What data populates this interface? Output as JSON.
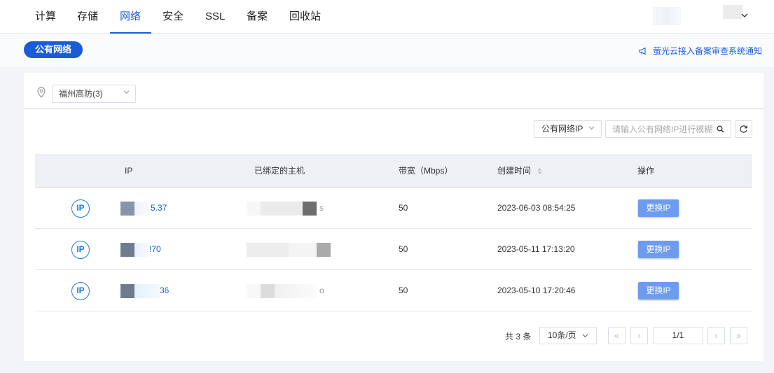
{
  "nav": {
    "tabs": [
      {
        "label": "计算"
      },
      {
        "label": "存储"
      },
      {
        "label": "网络"
      },
      {
        "label": "安全"
      },
      {
        "label": "SSL"
      },
      {
        "label": "备案"
      },
      {
        "label": "回收站"
      }
    ],
    "active_tab": "网络"
  },
  "subheader": {
    "pill_label": "公有网络",
    "notice_text": "萤光云接入备案审查系统通知"
  },
  "region": {
    "selected": "福州高防(3)"
  },
  "toolbar": {
    "filter_selected": "公有网络IP",
    "search_placeholder": "请输入公有网络IP进行模糊...",
    "icons": [
      "search-icon",
      "refresh-icon",
      "location-pin-icon",
      "megaphone-icon"
    ]
  },
  "table": {
    "columns": [
      "IP",
      "已绑定的主机",
      "带宽（Mbps）",
      "创建时间",
      "操作"
    ],
    "ip_icon_label": "IP",
    "action_label": "更换IP",
    "rows": [
      {
        "ip_visible": "5.37",
        "host_visible": "s",
        "bandwidth": "50",
        "created": "2023-06-03 08:54:25"
      },
      {
        "ip_visible": "!70",
        "host_visible": "",
        "bandwidth": "50",
        "created": "2023-05-11 17:13:20"
      },
      {
        "ip_visible": "36",
        "host_visible": "o",
        "bandwidth": "50",
        "created": "2023-05-10 17:20:46"
      }
    ]
  },
  "pager": {
    "total": "共 3 条",
    "page_size": "10条/页",
    "page": "1/1",
    "first": "«",
    "prev": "‹",
    "next": "›",
    "last": "»"
  },
  "colors": {
    "accent": "#1a5cd6",
    "button": "#6d9cef",
    "ip_icon": "#1a7ee0"
  }
}
